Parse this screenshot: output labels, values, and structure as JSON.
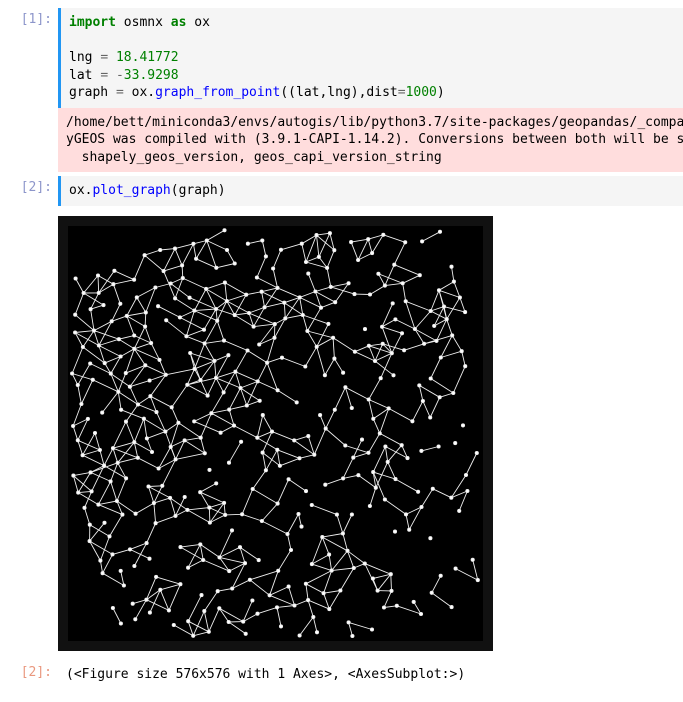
{
  "cells": {
    "c1": {
      "prompt": "[1]:",
      "code": {
        "l1_kw": "import",
        "l1_sp1": " osmnx ",
        "l1_as": "as",
        "l1_sp2": " ox",
        "l3_a": "lng ",
        "l3_eq": "=",
        "l3_sp": " ",
        "l3_num": "18.41772",
        "l4_a": "lat ",
        "l4_eq": "=",
        "l4_sp": " ",
        "l4_neg": "-",
        "l4_num": "33.9298",
        "l5_a": "graph ",
        "l5_eq": "=",
        "l5_b": " ox.",
        "l5_fn": "graph_from_point",
        "l5_c": "((lat,lng),dist",
        "l5_eq2": "=",
        "l5_num": "1000",
        "l5_d": ")"
      },
      "stderr_l1": "/home/bett/miniconda3/envs/autogis/lib/python3.7/site-packages/geopandas/_compat",
      "stderr_l2": "yGEOS was compiled with (3.9.1-CAPI-1.14.2). Conversions between both will be sl",
      "stderr_l3": "  shapely_geos_version, geos_capi_version_string"
    },
    "c2": {
      "prompt": "[2]:",
      "code": {
        "a": "ox.",
        "fn": "plot_graph",
        "b": "(graph)"
      }
    },
    "c3": {
      "prompt": "[2]:",
      "text": "(<Figure size 576x576 with 1 Axes>, <AxesSubplot:>)"
    }
  }
}
